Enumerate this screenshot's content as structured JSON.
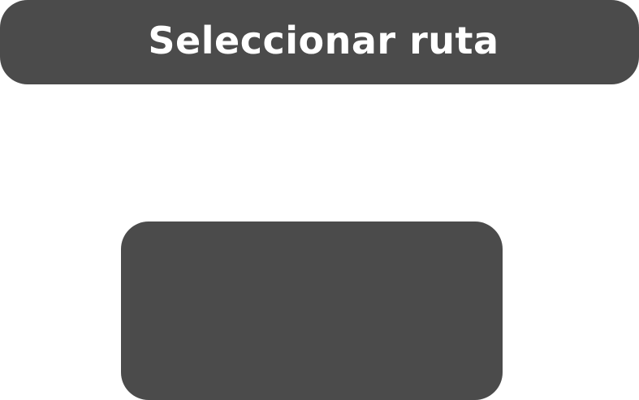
{
  "header": {
    "title": "Seleccionar ruta"
  },
  "colors": {
    "panel": "#4b4b4b",
    "text": "#ffffff",
    "background": "#ffffff"
  }
}
